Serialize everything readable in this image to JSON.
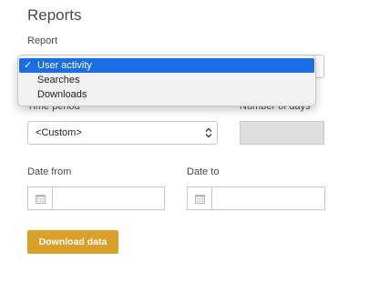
{
  "page": {
    "title": "Reports"
  },
  "report": {
    "label": "Report",
    "options": [
      "User activity",
      "Searches",
      "Downloads"
    ],
    "selected_check": "✓"
  },
  "time_period": {
    "label": "Time period",
    "value": "<Custom>"
  },
  "number_of_days": {
    "label": "Number of days",
    "value": ""
  },
  "date_from": {
    "label": "Date from",
    "value": ""
  },
  "date_to": {
    "label": "Date to",
    "value": ""
  },
  "actions": {
    "download_label": "Download data",
    "accent_color": "#d9a02a"
  },
  "icons": {
    "calendar": "calendar-icon",
    "select_arrows": "up-down-chevron-icon",
    "check": "checkmark-icon"
  }
}
